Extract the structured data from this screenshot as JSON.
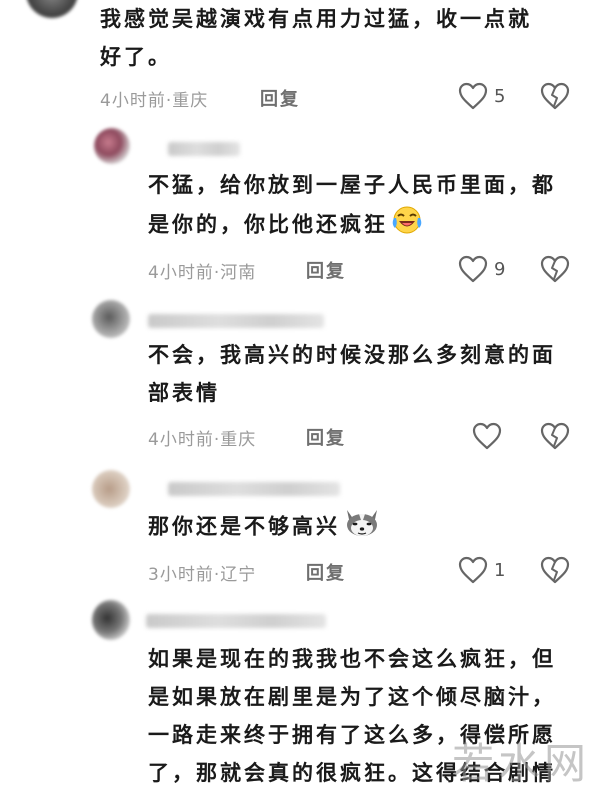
{
  "comments": [
    {
      "lines": [
        "我感觉吴越演戏有点用力过猛，收一点就",
        "好了。"
      ],
      "meta": "4小时前·重庆",
      "reply_label": "回复",
      "likes": "5"
    },
    {
      "lines": [
        "不猛，给你放到一屋子人民币里面，都",
        "是你的，你比他还疯狂"
      ],
      "meta": "4小时前·河南",
      "reply_label": "回复",
      "likes": "9"
    },
    {
      "lines": [
        "不会，我高兴的时候没那么多刻意的面",
        "部表情"
      ],
      "meta": "4小时前·重庆",
      "reply_label": "回复",
      "likes": ""
    },
    {
      "lines": [
        "那你还是不够高兴"
      ],
      "meta": "3小时前·辽宁",
      "reply_label": "回复",
      "likes": "1"
    },
    {
      "lines": [
        "如果是现在的我我也不会这么疯狂，但",
        "是如果放在剧里是为了这个倾尽脑汁，",
        "一路走来终于拥有了这么多，得偿所愿",
        "了，那就会真的很疯狂。这得结合剧情"
      ]
    }
  ],
  "watermark": "若水网"
}
